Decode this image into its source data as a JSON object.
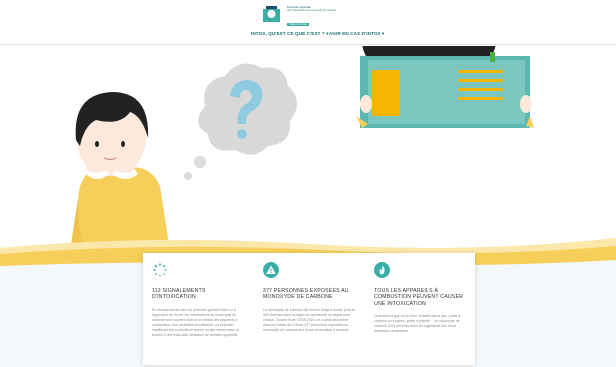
{
  "header": {
    "logo": {
      "line1": "Prévention régionale",
      "line2": "des intoxications au monoxyde de carbone",
      "tag": "Hauts-de-France"
    },
    "nav": [
      {
        "label": "INTOX, QU'EST CE QUE C'EST ? ▾"
      },
      {
        "label": "AGIR EN CAS D'INTOX ▾"
      }
    ]
  },
  "colors": {
    "accent": "#3aaea6",
    "yellow": "#f6cf5a",
    "teal_book": "#5bb7b0",
    "question": "#8fcbe0"
  },
  "cards": [
    {
      "icon": "loading-dots-icon",
      "title": "112 SIGNALEMENTS D'INTOXICATION",
      "text": "En recrudescence dès les premiers grands froids ou à l'approche de l'hiver, les intoxications au monoxyde de carbone sont souvent dues à un défaut des appareils à combustion, une ventilation insuffisante, un entretien insuffisant des conduits de fumée ou des chemi-nées ou encore à une mauvaise utilisation de certains appareils"
    },
    {
      "icon": "warning-icon",
      "title": "377 PERSONNES EXPOSÉES AU MONOXYDE DE CARBONE",
      "text": "Le monoxyde de carbone fait encore chaque année plus de 300 victimes dans la région et représente un risque pour chacun. Durant l'hiver 2018-2019, on a ainsi dénombré dans les Hauts-de-France 377 personnes exposées au monoxyde de carbone lors d'une intoxication à domicile"
    },
    {
      "icon": "flame-icon",
      "title": "TOUS LES APPAREILS À COMBUSTION PEUVENT CAUSER UNE INTOXICATION",
      "text": "Chaudière à gaz ou au fioul, chauffe-eau à gaz, poêle à charbon ou à pavés, poêle à pétrole... Le monoxyde de carbone (CO) est émis dans les logements lors d'une mauvaise combustion"
    }
  ]
}
